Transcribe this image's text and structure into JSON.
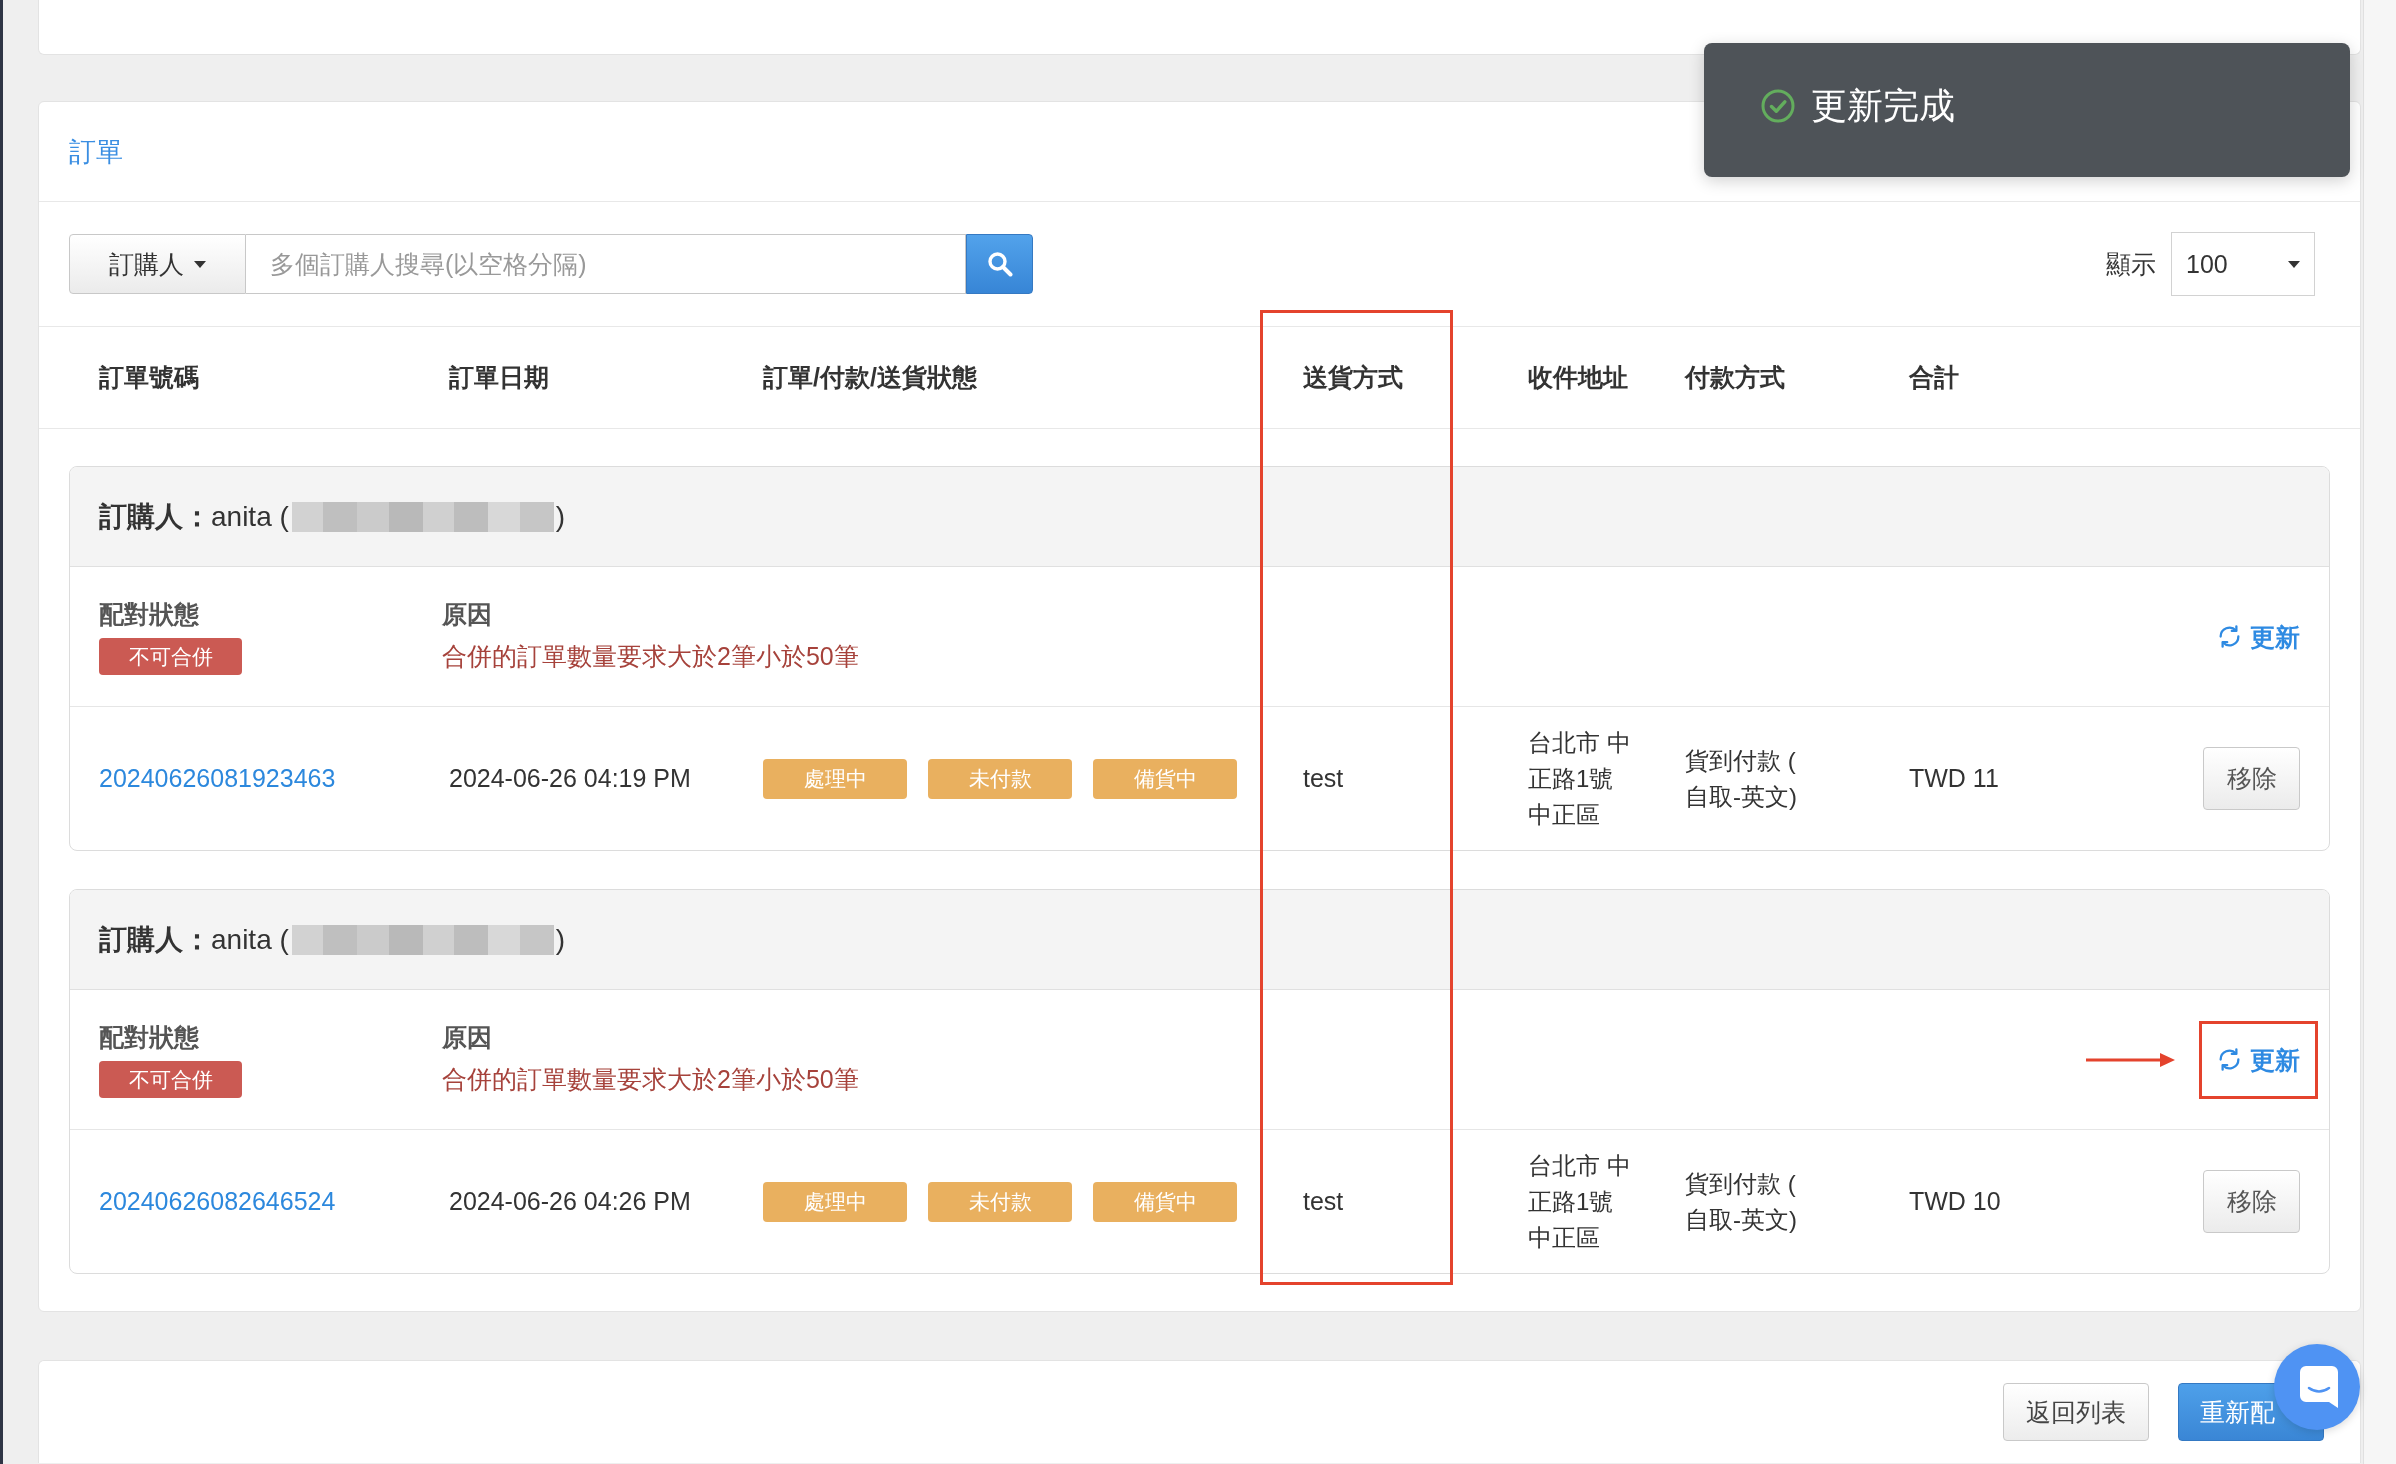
{
  "toast": {
    "kind": "success",
    "message": "更新完成"
  },
  "orders_panel": {
    "title": "訂單",
    "search": {
      "filter": "訂購人",
      "placeholder": "多個訂購人搜尋(以空格分隔)"
    },
    "page_size": {
      "label": "顯示",
      "value": "100"
    },
    "table": {
      "columns": [
        {
          "label": "訂單號碼",
          "highlighted": false
        },
        {
          "label": "訂單日期",
          "highlighted": false
        },
        {
          "label": "訂單/付款/送貨狀態",
          "highlighted": false
        },
        {
          "label": "送貨方式",
          "highlighted": true
        },
        {
          "label": "收件地址",
          "highlighted": false
        },
        {
          "label": "付款方式",
          "highlighted": false
        },
        {
          "label": "合計",
          "highlighted": false
        }
      ],
      "groups": [
        {
          "buyer": "**訂購人：**anita (",
          "buyer_end": ")",
          "match": {
            "label": "配對狀態",
            "mergeable": false,
            "status": "不可合併",
            "reason_label": "原因",
            "reason": "合併的訂單數量要求大於2筆小於50筆"
          },
          "update": {
            "label": "更新",
            "highlighted": false
          },
          "orders": [
            {
              "number": "20240626081923463",
              "date": "2024-06-26 04:19 PM",
              "statuses": [
                "處理中",
                "未付款",
                "備貨中"
              ],
              "shipping": "test",
              "address": [
                "台北市 中",
                "正路1號",
                "中正區"
              ],
              "payment": [
                "貨到付款 (",
                "自取-英文)"
              ],
              "total": "TWD 11",
              "remove": "移除"
            }
          ]
        },
        {
          "buyer": "**訂購人：**anita (",
          "buyer_end": ")",
          "match": {
            "label": "配對狀態",
            "mergeable": false,
            "status": "不可合併",
            "reason_label": "原因",
            "reason": "合併的訂單數量要求大於2筆小於50筆"
          },
          "update": {
            "label": "更新",
            "highlighted": true
          },
          "orders": [
            {
              "number": "20240626082646524",
              "date": "2024-06-26 04:26 PM",
              "statuses": [
                "處理中",
                "未付款",
                "備貨中"
              ],
              "shipping": "test",
              "address": [
                "台北市 中",
                "正路1號",
                "中正區"
              ],
              "payment": [
                "貨到付款 (",
                "自取-英文)"
              ],
              "total": "TWD 10",
              "remove": "移除"
            }
          ]
        }
      ]
    }
  },
  "footer": {
    "buttons": [
      {
        "label": "返回列表",
        "kind": "default"
      },
      {
        "label": "重新配",
        "kind": "primary"
      }
    ]
  }
}
